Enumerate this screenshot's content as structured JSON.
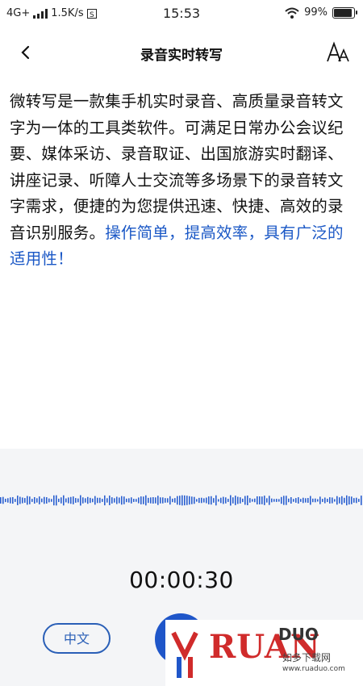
{
  "status": {
    "network": "4G+",
    "speed": "1.5K/s",
    "time": "15:53",
    "battery": "99%",
    "battery_level": 0.99
  },
  "header": {
    "title": "录音实时转写"
  },
  "content": {
    "text": "微转写是一款集手机实时录音、高质量录音转文字为一体的工具类软件。可满足日常办公会议纪要、媒体采访、录音取证、出国旅游实时翻译、讲座记录、听障人士交流等多场景下的录音转文字需求，便捷的为您提供迅速、快捷、高效的录音识别服务。",
    "highlight": "操作简单，提高效率，具有广泛的适用性！"
  },
  "recording": {
    "timer": "00:00:30",
    "language": "中文",
    "record_label": "山"
  },
  "watermark": {
    "brand": "RUAN",
    "brand2": "DUO",
    "name": "如多下载网",
    "url": "www.ruaduo.com"
  },
  "colors": {
    "accent": "#1b58c6",
    "wave": "#2a5fd0"
  }
}
